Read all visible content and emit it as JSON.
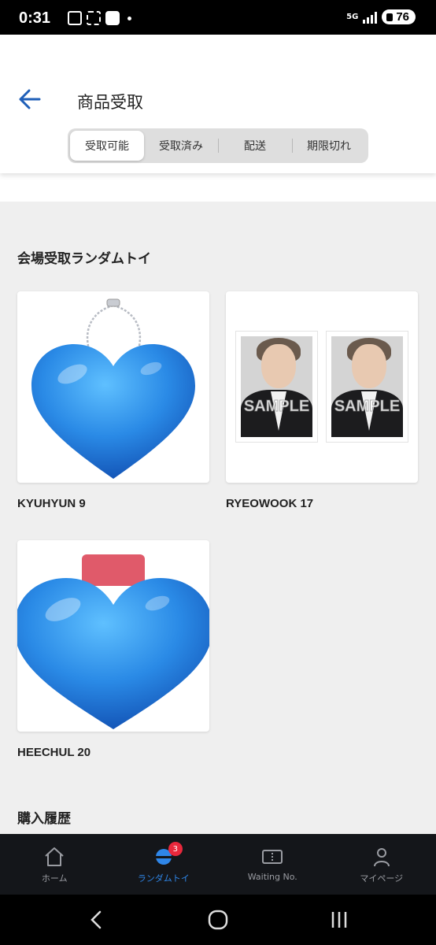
{
  "status_bar": {
    "time": "0:31",
    "network": "5G",
    "battery": "76"
  },
  "header": {
    "title": "商品受取",
    "tabs": [
      {
        "label": "受取可能",
        "active": true
      },
      {
        "label": "受取済み",
        "active": false
      },
      {
        "label": "配送",
        "active": false
      },
      {
        "label": "期限切れ",
        "active": false
      }
    ]
  },
  "main": {
    "section_title": "会場受取ランダムトイ",
    "items": [
      {
        "label": "KYUHYUN 9",
        "image": "blue-heart-keychain"
      },
      {
        "label": "RYEOWOOK 17",
        "image": "photo-cards",
        "watermark": "SAMPLE"
      },
      {
        "label": "HEECHUL 20",
        "image": "blue-heart-keychain"
      }
    ],
    "next_section_title": "購入履歴"
  },
  "bottom_nav": {
    "items": [
      {
        "label": "ホーム",
        "icon": "home-icon",
        "active": false
      },
      {
        "label": "ランダムトイ",
        "icon": "random-toy-icon",
        "active": true,
        "badge": "3"
      },
      {
        "label": "Waiting No.",
        "icon": "ticket-icon",
        "active": false
      },
      {
        "label": "マイページ",
        "icon": "person-icon",
        "active": false
      }
    ]
  },
  "colors": {
    "accent": "#2f86e8",
    "badge": "#e8283c",
    "back_arrow": "#1f5fb8",
    "heart": "#2a8ae6"
  }
}
